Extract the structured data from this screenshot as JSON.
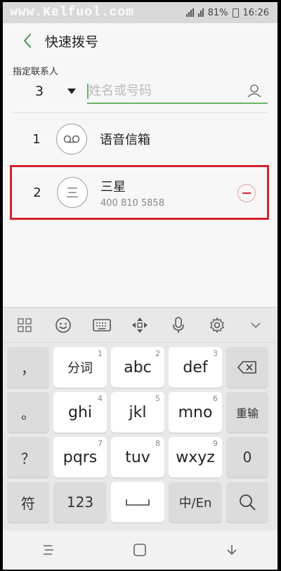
{
  "status_bar": {
    "watermark": "www.Kelfuol.com",
    "battery": "81%",
    "time": "16:26"
  },
  "app_bar": {
    "title": "快速拨号",
    "back_icon": "back-arrow-icon"
  },
  "assign": {
    "label": "指定联系人",
    "selected_number": "3",
    "search_placeholder": "姓名或号码",
    "search_value": ""
  },
  "speed_dials": [
    {
      "number": "1",
      "name": "语音信箱",
      "phone": "",
      "icon": "voicemail-icon"
    },
    {
      "number": "2",
      "name": "三星",
      "phone": "400 810 5858",
      "avatar_letter": "三",
      "icon": "contact-avatar"
    }
  ],
  "keyboard": {
    "toolbar_icons": [
      "grid-icon",
      "emoji-icon",
      "keyboard-icon",
      "move-icon",
      "mic-icon",
      "gear-icon",
      "chevron-down-icon"
    ],
    "rows": [
      [
        {
          "label": "，",
          "sup": ""
        },
        {
          "label": "分词",
          "sup": "1"
        },
        {
          "label": "abc",
          "sup": "2"
        },
        {
          "label": "def",
          "sup": "3"
        },
        {
          "label": "",
          "sup": "",
          "icon": "backspace-icon"
        }
      ],
      [
        {
          "label": "。",
          "sup": ""
        },
        {
          "label": "ghi",
          "sup": "4"
        },
        {
          "label": "jkl",
          "sup": "5"
        },
        {
          "label": "mno",
          "sup": "6"
        },
        {
          "label": "重输",
          "sup": ""
        }
      ],
      [
        {
          "label": "？",
          "sup": ""
        },
        {
          "label": "pqrs",
          "sup": "7"
        },
        {
          "label": "tuv",
          "sup": "8"
        },
        {
          "label": "wxyz",
          "sup": "9"
        },
        {
          "label": "0",
          "sup": ""
        }
      ],
      [
        {
          "label": "符",
          "sup": ""
        },
        {
          "label": "123",
          "sup": ""
        },
        {
          "label": "",
          "sup": "",
          "icon": "space-icon"
        },
        {
          "label": "中/En",
          "sup": ""
        },
        {
          "label": "",
          "sup": "",
          "icon": "search-icon"
        }
      ]
    ]
  },
  "nav_bar": {
    "icons": [
      "recent-apps-icon",
      "home-icon",
      "back-icon"
    ]
  }
}
